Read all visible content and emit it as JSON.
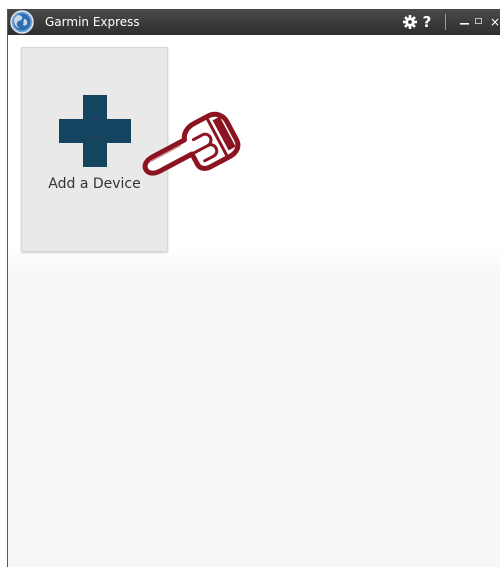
{
  "window": {
    "title": "Garmin Express",
    "controls": {
      "settings_icon": "gear-icon",
      "help_label": "?",
      "minimize_icon": "minimize-icon",
      "maximize_icon": "maximize-icon",
      "close_label": "×"
    }
  },
  "main": {
    "tiles": [
      {
        "label": "Add a Device",
        "icon": "plus-icon"
      }
    ]
  },
  "colors": {
    "titlebar": "#3a3a3a",
    "plus": "#154460",
    "tile": "#e9e9e9",
    "pointer": "#8b1420"
  }
}
